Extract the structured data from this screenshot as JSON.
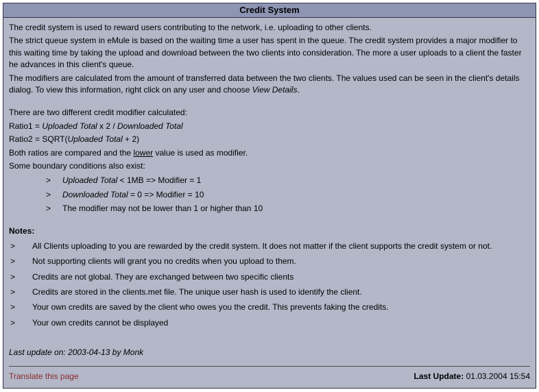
{
  "title": "Credit System",
  "intro": {
    "p1": "The credit system is used to reward users contributing to the network, i.e. uploading to other clients.",
    "p2": "The strict queue system in eMule is based on the waiting time a user has spent in the queue. The credit system provides a major modifier to this waiting time by taking the upload and download between the two clients into consideration. The more a user uploads to a client the faster he advances in this client's queue.",
    "p3_a": "The modifiers are calculated from the amount of transferred data between the two clients. The values used can be seen in the client's details dialog. To view this information, right click on any user and choose ",
    "p3_b": "View Details",
    "p3_c": "."
  },
  "calc": {
    "lead": "There are two different credit modifier calculated:",
    "ratio1": {
      "pre": "Ratio1 = ",
      "a": "Uploaded Total",
      "mid": " x 2 / ",
      "b": "Downloaded Total"
    },
    "ratio2": {
      "pre": "Ratio2 = SQRT(",
      "a": "Uploaded Total",
      "post": " + 2)"
    },
    "compare_a": "Both ratios are compared and the ",
    "compare_lower": "lower",
    "compare_b": " value is used as modifier.",
    "boundary_lead": "Some boundary conditions also exist:",
    "cond1": {
      "a": "Uploaded Total",
      "b": " < 1MB => Modifier = 1"
    },
    "cond2": {
      "a": "Downloaded Total",
      "b": " = 0 => Modifier = 10"
    },
    "cond3": "The modifier may not be lower than 1 or higher than 10"
  },
  "notes": {
    "head": "Notes:",
    "items": [
      "All Clients uploading to you are rewarded by the credit system. It does not matter if the client supports the credit system or not.",
      "Not supporting clients will grant you no credits when you upload to them.",
      "Credits are not global. They are exchanged between two specific clients",
      "Credits are stored in the clients.met file. The unique user hash is used to identify the client.",
      "Your own credits are saved by the client who owes you the credit. This prevents faking the credits.",
      "Your own credits cannot be displayed"
    ]
  },
  "content_last_update": "Last update on: 2003-04-13 by Monk",
  "footer": {
    "translate": "Translate this page",
    "label": "Last Update:",
    "value": " 01.03.2004 15:54"
  }
}
